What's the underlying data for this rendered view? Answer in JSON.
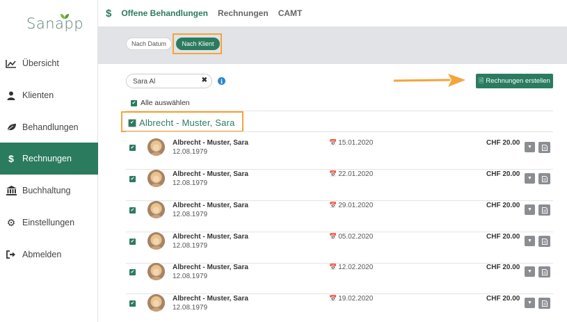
{
  "app": {
    "logo": "Sanapp"
  },
  "sidebar": {
    "items": [
      {
        "label": "Übersicht",
        "icon": "chart-line-icon"
      },
      {
        "label": "Klienten",
        "icon": "user-icon"
      },
      {
        "label": "Behandlungen",
        "icon": "leaf-icon"
      },
      {
        "label": "Rechnungen",
        "icon": "dollar-icon",
        "active": true
      },
      {
        "label": "Buchhaltung",
        "icon": "bank-icon"
      },
      {
        "label": "Einstellungen",
        "icon": "gear-icon"
      },
      {
        "label": "Abmelden",
        "icon": "sign-out-icon"
      }
    ]
  },
  "topbar": {
    "icon": "$",
    "tabs": [
      {
        "label": "Offene Behandlungen",
        "active": true
      },
      {
        "label": "Rechnungen"
      },
      {
        "label": "CAMT"
      }
    ]
  },
  "filter": {
    "by_date": "Nach Datum",
    "by_client": "Nach Klient"
  },
  "search": {
    "value": "Sara Al"
  },
  "actions": {
    "create_invoices": "Rechnungen erstellen"
  },
  "select_all": {
    "label": "Alle auswählen"
  },
  "group": {
    "title": "Albrecht - Muster, Sara"
  },
  "rows": [
    {
      "name": "Albrecht - Muster, Sara",
      "dob": "12.08.1979",
      "date": "15.01.2020",
      "amount": "CHF 20.00"
    },
    {
      "name": "Albrecht - Muster, Sara",
      "dob": "12.08.1979",
      "date": "22.01.2020",
      "amount": "CHF 20.00"
    },
    {
      "name": "Albrecht - Muster, Sara",
      "dob": "12.08.1979",
      "date": "29.01.2020",
      "amount": "CHF 20.00"
    },
    {
      "name": "Albrecht - Muster, Sara",
      "dob": "12.08.1979",
      "date": "05.02.2020",
      "amount": "CHF 20.00"
    },
    {
      "name": "Albrecht - Muster, Sara",
      "dob": "12.08.1979",
      "date": "12.02.2020",
      "amount": "CHF 20.00"
    },
    {
      "name": "Albrecht - Muster, Sara",
      "dob": "12.08.1979",
      "date": "19.02.2020",
      "amount": "CHF 20.00"
    }
  ],
  "colors": {
    "brand": "#2b7b5f",
    "highlight": "#f4a43a",
    "info": "#2a86c9"
  }
}
